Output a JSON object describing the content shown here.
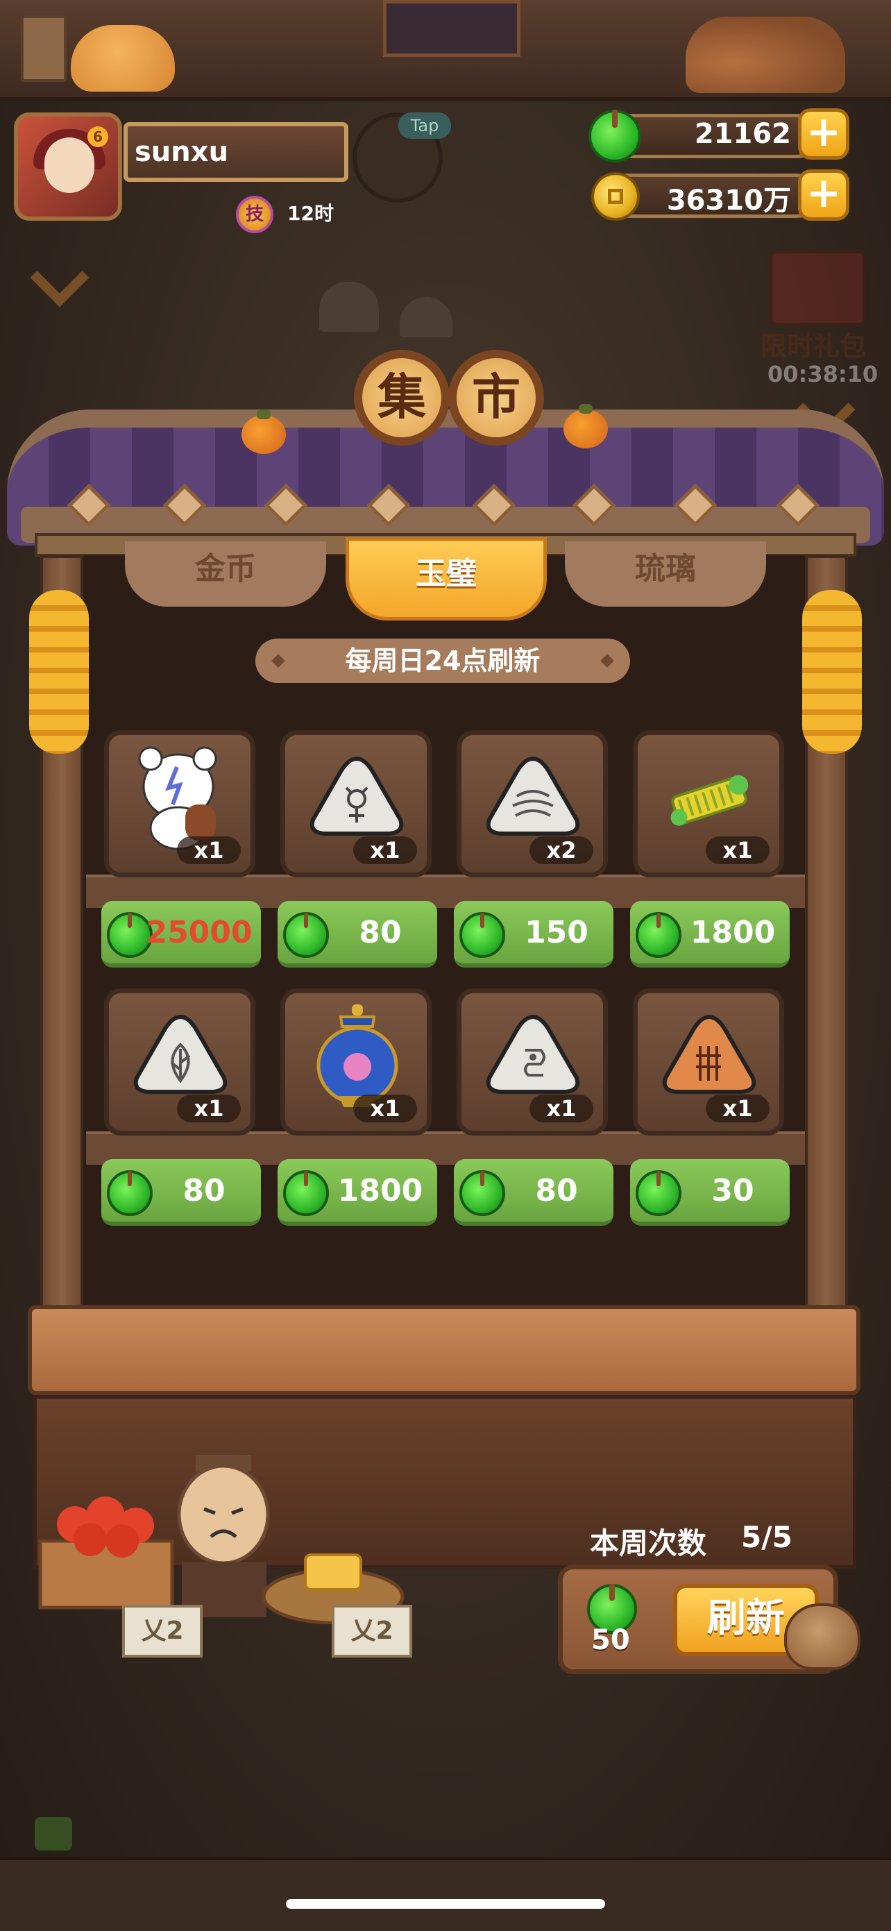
{
  "player": {
    "name": "sunxu",
    "skill_icon_char": "技",
    "skill_time": "12时",
    "tap_label": "Tap"
  },
  "currency": {
    "jade": "21162",
    "coins": "36310万",
    "plus": "+"
  },
  "gift": {
    "label": "限时礼包",
    "timer": "00:38:10"
  },
  "market": {
    "title_chars": [
      "集",
      "市"
    ],
    "tabs": [
      {
        "label": "金币",
        "active": false
      },
      {
        "label": "玉璧",
        "active": true
      },
      {
        "label": "琉璃",
        "active": false
      }
    ],
    "refresh_notice": "每周日24点刷新",
    "items": [
      {
        "icon": "bear-musician-icon",
        "qty": "x1",
        "price": "25000",
        "price_red": true
      },
      {
        "icon": "stone-tablet-knot-icon",
        "qty": "x1",
        "price": "80",
        "price_red": false
      },
      {
        "icon": "stone-tablet-waves-icon",
        "qty": "x2",
        "price": "150",
        "price_red": false
      },
      {
        "icon": "jade-comb-icon",
        "qty": "x1",
        "price": "1800",
        "price_red": false
      },
      {
        "icon": "stone-tablet-leaf-icon",
        "qty": "x1",
        "price": "80",
        "price_red": false
      },
      {
        "icon": "cloisonne-vase-icon",
        "qty": "x1",
        "price": "1800",
        "price_red": false
      },
      {
        "icon": "stone-tablet-spiral-icon",
        "qty": "x1",
        "price": "80",
        "price_red": false
      },
      {
        "icon": "clay-tablet-glyph-icon",
        "qty": "x1",
        "price": "30",
        "price_red": false
      }
    ],
    "week_label": "本周次数",
    "week_count": "5/5",
    "refresh_cost": "50",
    "refresh_button": "刷新"
  },
  "stalls": {
    "sign_left": "乂2",
    "sign_right": "乂2"
  },
  "colors": {
    "price_green": "#7bb84c",
    "price_red": "#e64a2c",
    "tab_active": "#f4a62a",
    "roof_purple": "#5e4377"
  }
}
